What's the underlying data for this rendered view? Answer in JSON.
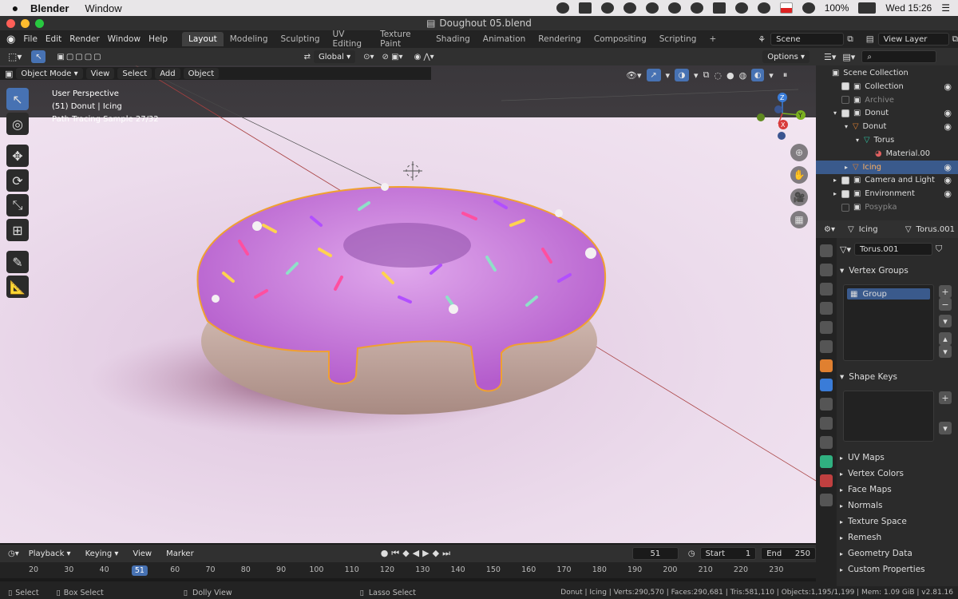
{
  "macos_menubar": {
    "apple": "",
    "app_name": "Blender",
    "items": [
      "Window"
    ],
    "battery": "100%",
    "clock": "Wed 15:26"
  },
  "window": {
    "title": "Doughout 05.blend"
  },
  "topbar": {
    "menus": [
      "File",
      "Edit",
      "Render",
      "Window",
      "Help"
    ],
    "workspaces": [
      "Layout",
      "Modeling",
      "Sculpting",
      "UV Editing",
      "Texture Paint",
      "Shading",
      "Animation",
      "Rendering",
      "Compositing",
      "Scripting"
    ],
    "active_workspace": "Layout",
    "add_tab": "+",
    "scene": "Scene",
    "view_layer": "View Layer"
  },
  "viewport_header": {
    "transform_orientation": "Global",
    "options": "Options",
    "mode": "Object Mode",
    "menus": [
      "View",
      "Select",
      "Add",
      "Object"
    ]
  },
  "viewport": {
    "overlay": {
      "line1": "User Perspective",
      "line2": "(51) Donut | Icing",
      "line3": "Path Tracing Sample 27/32"
    },
    "gizmo": {
      "z": "Z",
      "y": "Y",
      "x": "X"
    }
  },
  "outliner": {
    "root": "Scene Collection",
    "rows": [
      {
        "label": "Collection",
        "indent": 0,
        "checked": true,
        "eye": true,
        "dim": false,
        "selected": false,
        "icon": "collection"
      },
      {
        "label": "Archive",
        "indent": 0,
        "checked": false,
        "eye": false,
        "dim": true,
        "selected": false,
        "icon": "collection"
      },
      {
        "label": "Donut",
        "indent": 0,
        "checked": true,
        "eye": true,
        "dim": false,
        "selected": false,
        "icon": "collection",
        "expand": "▾"
      },
      {
        "label": "Donut",
        "indent": 1,
        "checked": false,
        "eye": true,
        "dim": false,
        "selected": false,
        "icon": "mesh",
        "expand": "▾"
      },
      {
        "label": "Torus",
        "indent": 2,
        "checked": false,
        "eye": false,
        "dim": false,
        "selected": false,
        "icon": "mesh-data",
        "expand": "▾"
      },
      {
        "label": "Material.00",
        "indent": 3,
        "checked": false,
        "eye": false,
        "dim": false,
        "selected": false,
        "icon": "material"
      },
      {
        "label": "Icing",
        "indent": 1,
        "checked": false,
        "eye": true,
        "dim": false,
        "selected": true,
        "icon": "mesh",
        "expand": "▸"
      },
      {
        "label": "Camera and Light",
        "indent": 0,
        "checked": true,
        "eye": true,
        "dim": false,
        "selected": false,
        "icon": "collection",
        "expand": "▸"
      },
      {
        "label": "Environment",
        "indent": 0,
        "checked": true,
        "eye": true,
        "dim": false,
        "selected": false,
        "icon": "collection",
        "expand": "▸"
      },
      {
        "label": "Posypka",
        "indent": 0,
        "checked": false,
        "eye": false,
        "dim": true,
        "selected": false,
        "icon": "collection"
      }
    ]
  },
  "properties": {
    "object": "Icing",
    "data": "Torus.001",
    "mesh_name": "Torus.001",
    "vertex_groups": {
      "title": "Vertex Groups",
      "items": [
        "Group"
      ]
    },
    "shape_keys": {
      "title": "Shape Keys"
    },
    "collapsed_panels": [
      "UV Maps",
      "Vertex Colors",
      "Face Maps",
      "Normals",
      "Texture Space",
      "Remesh",
      "Geometry Data",
      "Custom Properties"
    ]
  },
  "timeline": {
    "menus": [
      "Playback",
      "Keying",
      "View",
      "Marker"
    ],
    "current_frame": "51",
    "start_label": "Start",
    "start": "1",
    "end_label": "End",
    "end": "250",
    "ticks": [
      "20",
      "30",
      "40",
      "51",
      "60",
      "70",
      "80",
      "90",
      "100",
      "110",
      "120",
      "130",
      "140",
      "150",
      "160",
      "170",
      "180",
      "190",
      "200",
      "210",
      "220",
      "230"
    ]
  },
  "statusbar": {
    "select": "Select",
    "box_select": "Box Select",
    "dolly": "Dolly View",
    "lasso": "Lasso Select",
    "stats": "Donut | Icing | Verts:290,570 | Faces:290,681 | Tris:581,110 | Objects:1,195/1,199 | Mem: 1.09 GiB | v2.81.16"
  },
  "colors": {
    "accent": "#4772b3",
    "selection": "#3a5a8c",
    "outline": "#f0a030",
    "icing": "#c870d8",
    "dough": "#d8b8a8"
  }
}
